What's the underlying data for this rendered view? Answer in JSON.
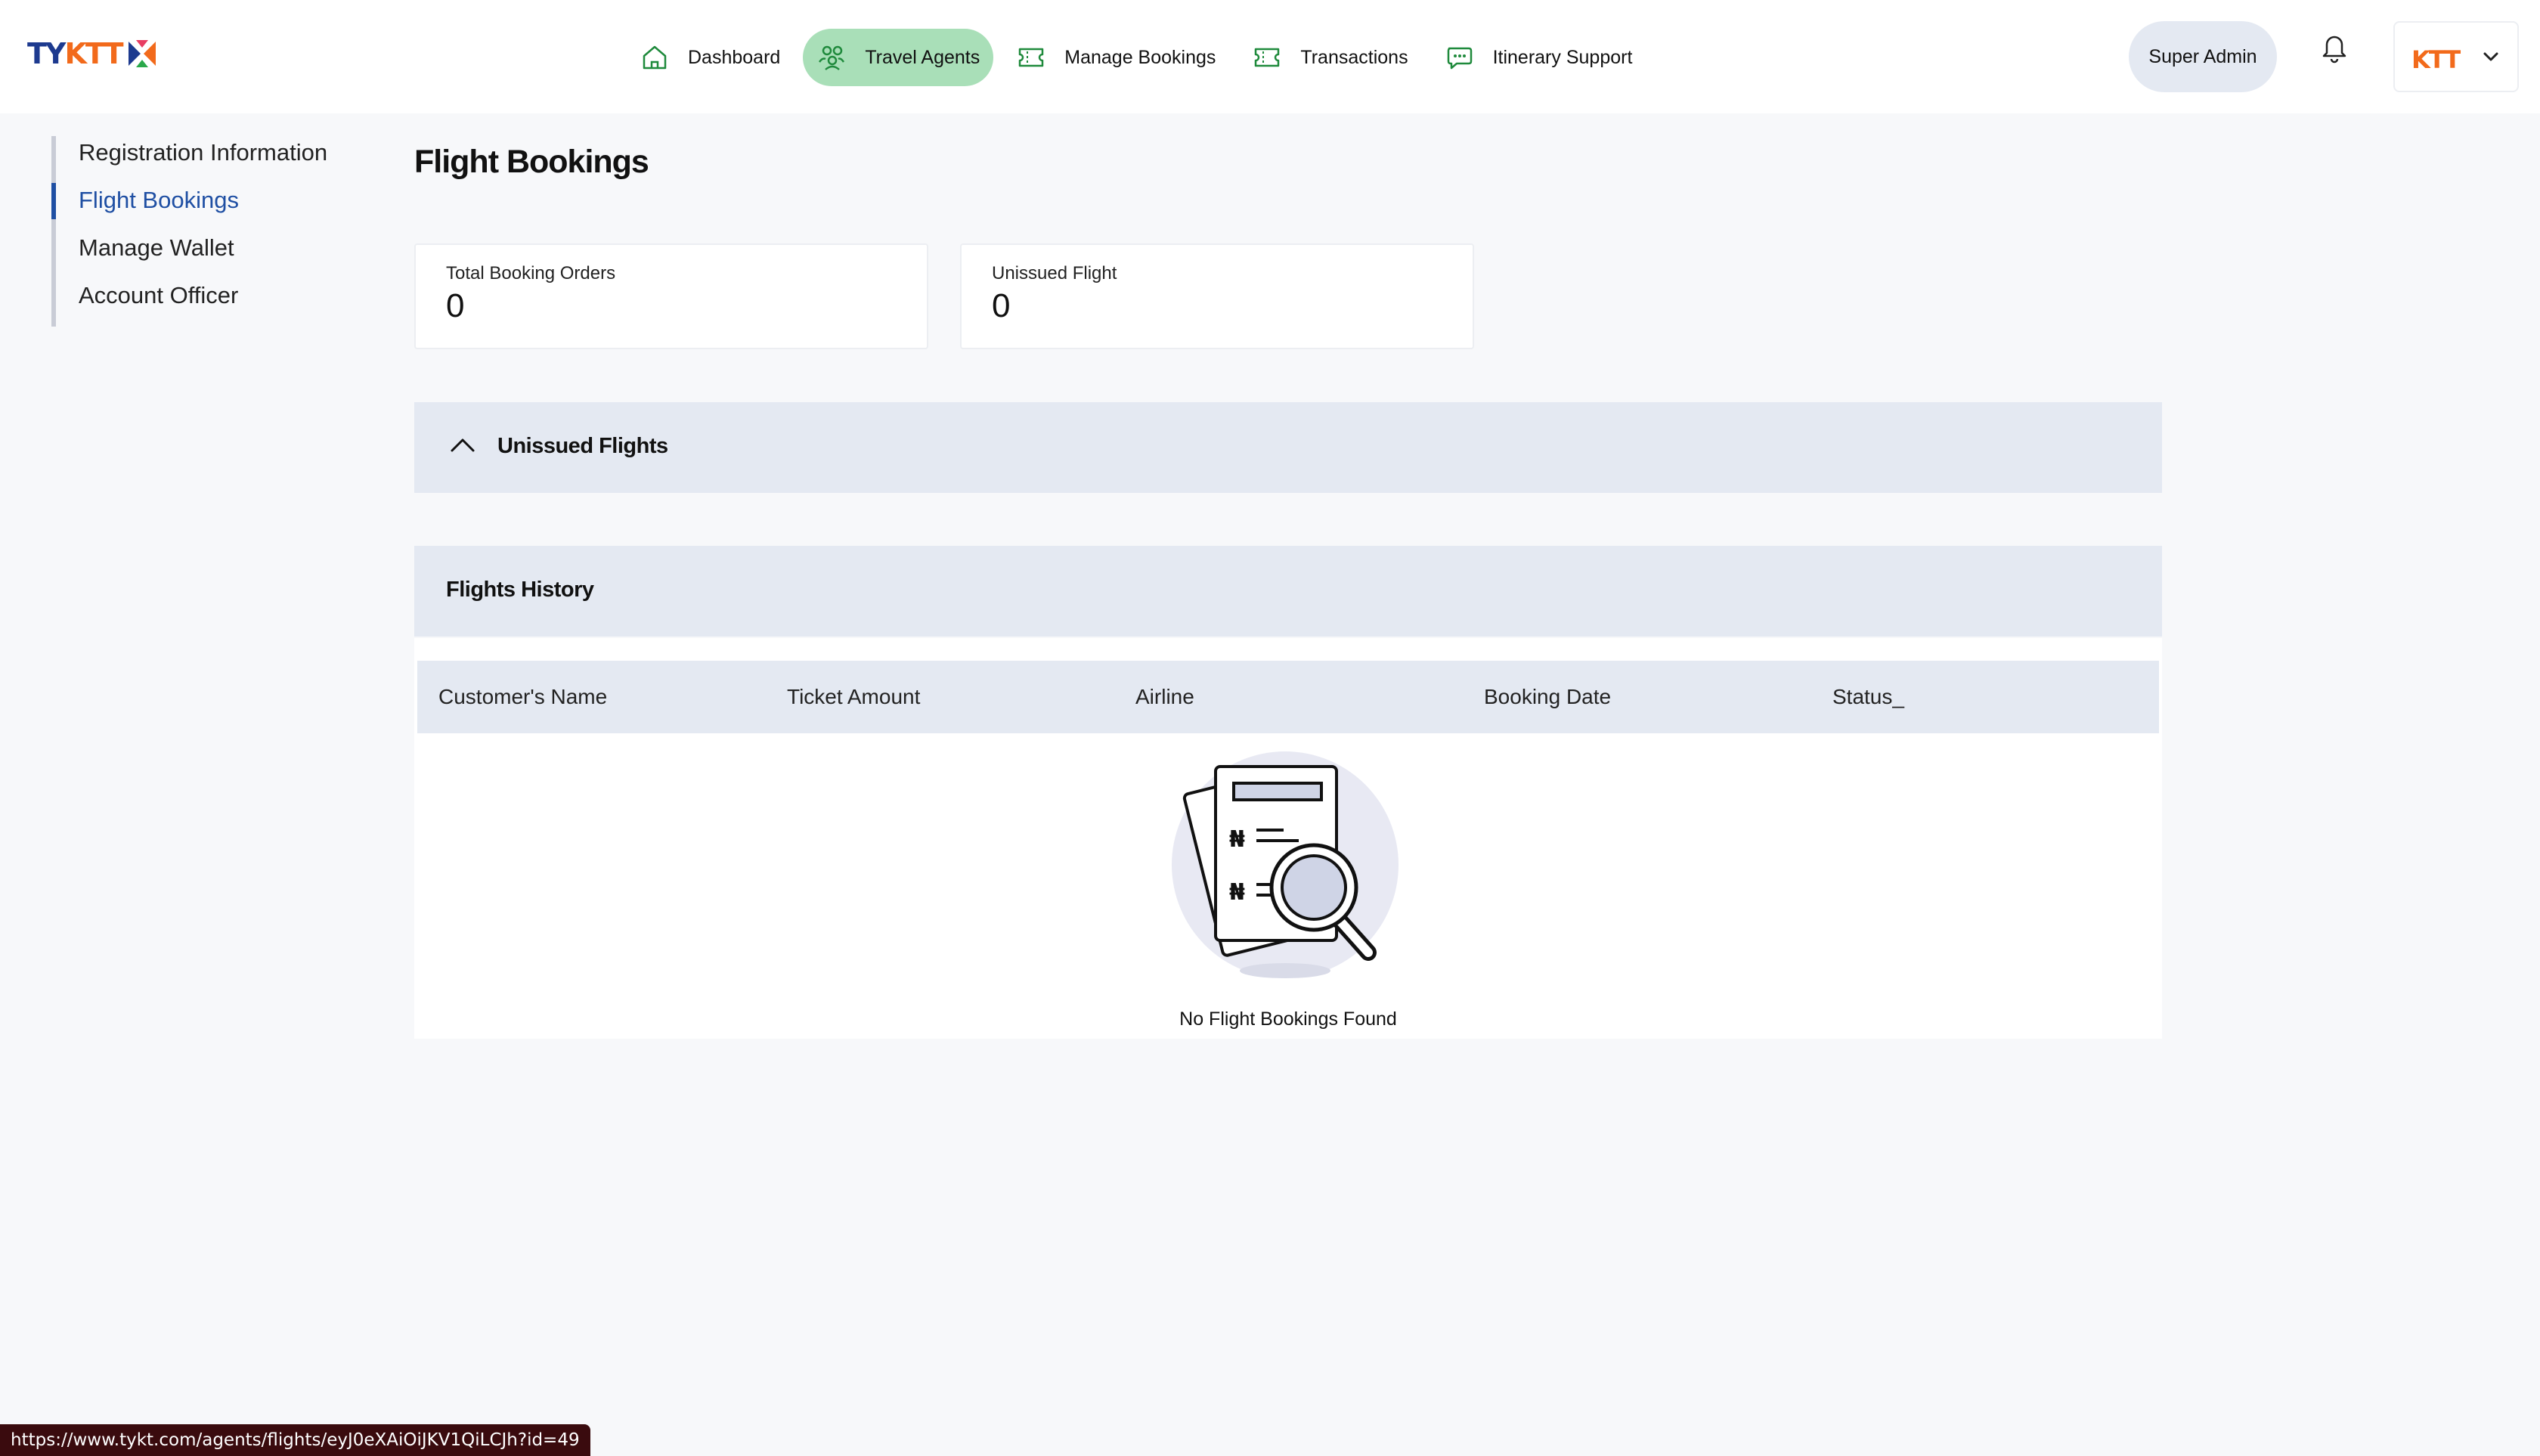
{
  "brand": {
    "logo_text_a": "TY",
    "logo_text_b": "KTT",
    "org_logo_text": "KTT"
  },
  "nav": {
    "items": [
      {
        "label": "Dashboard",
        "icon": "home-icon",
        "active": false
      },
      {
        "label": "Travel Agents",
        "icon": "agents-icon",
        "active": true
      },
      {
        "label": "Manage Bookings",
        "icon": "ticket-icon",
        "active": false
      },
      {
        "label": "Transactions",
        "icon": "ticket-icon",
        "active": false
      },
      {
        "label": "Itinerary Support",
        "icon": "chat-icon",
        "active": false
      }
    ]
  },
  "header": {
    "user_label": "Super Admin"
  },
  "sidebar": {
    "items": [
      {
        "label": "Registration Information",
        "active": false
      },
      {
        "label": "Flight Bookings",
        "active": true
      },
      {
        "label": "Manage Wallet",
        "active": false
      },
      {
        "label": "Account Officer",
        "active": false
      }
    ]
  },
  "main": {
    "title": "Flight Bookings",
    "stats": [
      {
        "label": "Total Booking Orders",
        "value": "0"
      },
      {
        "label": "Unissued Flight",
        "value": "0"
      }
    ],
    "unissued_panel_title": "Unissued Flights",
    "history_panel_title": "Flights History",
    "table": {
      "columns": [
        "Customer's Name",
        "Ticket Amount",
        "Airline",
        "Booking Date",
        "Status_"
      ],
      "empty_text": "No Flight Bookings Found"
    }
  },
  "status_bar": {
    "url": "https://www.tykt.com/agents/flights/eyJ0eXAiOiJKV1QiLCJh?id=49"
  },
  "colors": {
    "accent_green": "#a9dfb8",
    "brand_blue": "#1f4fa3",
    "panel_bg": "#e4e9f2",
    "page_bg": "#f7f8fa"
  }
}
